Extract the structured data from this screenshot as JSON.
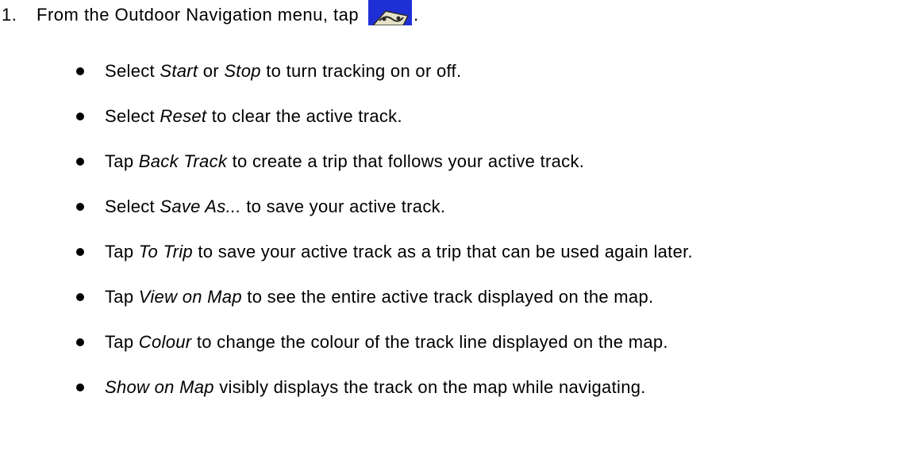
{
  "step": {
    "number": "1.",
    "text": "From the Outdoor Navigation menu, tap",
    "icon": "track-menu-icon",
    "trailing": "."
  },
  "bullets": [
    {
      "parts": [
        "Select ",
        "Start",
        " or ",
        "Stop",
        " to turn tracking on or off."
      ]
    },
    {
      "parts": [
        "Select ",
        "Reset",
        " to clear the active track."
      ]
    },
    {
      "parts": [
        "Tap ",
        "Back Track",
        " to create a trip that follows your active track."
      ]
    },
    {
      "parts": [
        "Select ",
        "Save As...",
        " to save your active track."
      ]
    },
    {
      "parts": [
        "Tap ",
        "To Trip",
        " to save your active track as a trip that can be used again later."
      ]
    },
    {
      "parts": [
        "Tap ",
        "View on Map",
        " to see the entire active track displayed on the map."
      ]
    },
    {
      "parts": [
        "Tap ",
        "Colour",
        " to change the colour of the track line displayed on the map."
      ]
    },
    {
      "parts": [
        "Show on Map",
        " visibly displays the track on the map while navigating."
      ]
    }
  ],
  "colors": {
    "icon_background": "#1f2fd6",
    "text": "#000000"
  }
}
